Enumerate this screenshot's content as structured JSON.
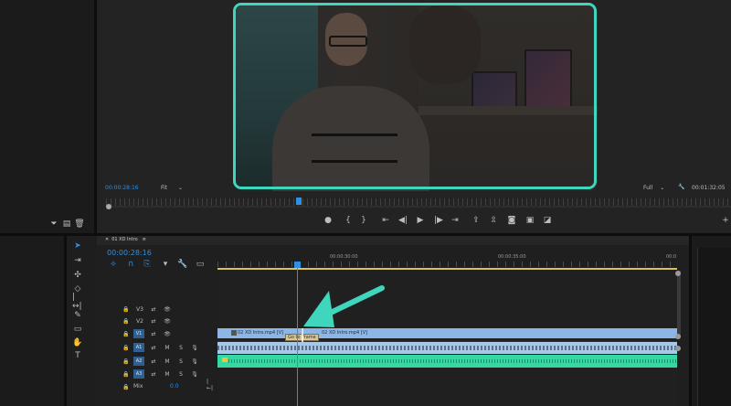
{
  "program_monitor": {
    "timecode": "00:00:28:16",
    "fit": "Fit",
    "quality": "Full",
    "duration": "00:01:32:05"
  },
  "timeline": {
    "tab_label": "01 XD Intro",
    "timecode": "00:00:28:16",
    "ruler": [
      "00:00:30:00",
      "00:00:35:00",
      "00:0"
    ],
    "tracks": [
      "V3",
      "V2",
      "V1",
      "A1",
      "A2",
      "A3"
    ],
    "master_label": "Mix",
    "master_value": "0.0",
    "clip_1": "02 XD Intro.mp4 [V]",
    "clip_2": "02 XD Intro.mp4 [V]",
    "tooltip": "Go to Frame"
  },
  "colors": {
    "accent_blue": "#2f8fe2",
    "video_clip": "#8bb6e6",
    "audio_clip": "#36d7a0",
    "annotation": "#3fd6bd"
  }
}
